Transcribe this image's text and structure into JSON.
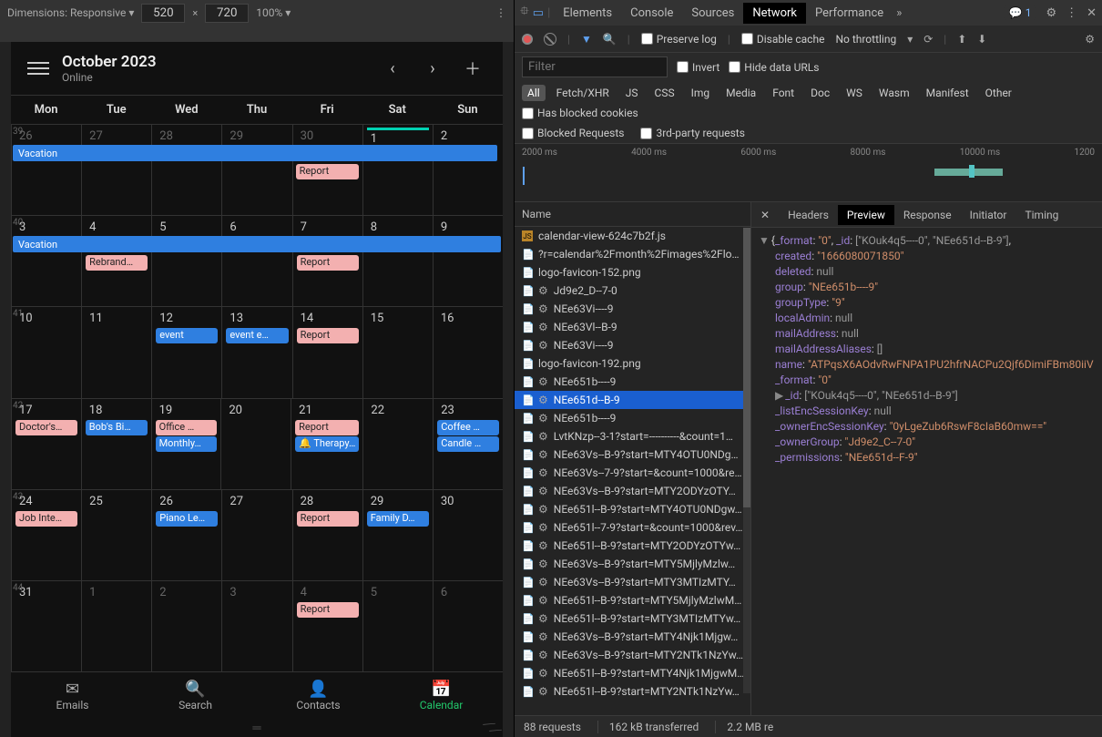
{
  "device": {
    "dimensions_label": "Dimensions: Responsive ▾",
    "width": "520",
    "height": "720",
    "zoom": "100% ▾"
  },
  "calendar": {
    "title": "October 2023",
    "status": "Online",
    "dow": [
      "Mon",
      "Tue",
      "Wed",
      "Thu",
      "Fri",
      "Sat",
      "Sun"
    ],
    "weeks": [
      {
        "no": "39",
        "days": [
          {
            "n": "26",
            "other": true
          },
          {
            "n": "27",
            "other": true
          },
          {
            "n": "28",
            "other": true
          },
          {
            "n": "29",
            "other": true
          },
          {
            "n": "30",
            "other": true
          },
          {
            "n": "1",
            "today": true
          },
          {
            "n": "2"
          }
        ],
        "span": {
          "label": "Vacation",
          "from": 0,
          "to": 7,
          "arrow": true
        }
      },
      {
        "no": "40",
        "days": [
          {
            "n": "3"
          },
          {
            "n": "4",
            "evts": [
              {
                "t": "Rebrand…",
                "c": "pink"
              }
            ]
          },
          {
            "n": "5"
          },
          {
            "n": "6"
          },
          {
            "n": "7",
            "evts": [
              {
                "t": "Report",
                "c": "pink"
              }
            ]
          },
          {
            "n": "8"
          },
          {
            "n": "9"
          }
        ],
        "span": {
          "label": "Vacation",
          "from": 0,
          "to": 7
        }
      },
      {
        "no": "41",
        "days": [
          {
            "n": "10"
          },
          {
            "n": "11"
          },
          {
            "n": "12",
            "evts": [
              {
                "t": "event",
                "c": "blue"
              }
            ]
          },
          {
            "n": "13",
            "evts": [
              {
                "t": "event e…",
                "c": "blue"
              }
            ]
          },
          {
            "n": "14",
            "evts": [
              {
                "t": "Report",
                "c": "pink"
              }
            ]
          },
          {
            "n": "15"
          },
          {
            "n": "16"
          }
        ]
      },
      {
        "no": "42",
        "days": [
          {
            "n": "17",
            "evts": [
              {
                "t": "Doctor's…",
                "c": "pink"
              }
            ]
          },
          {
            "n": "18",
            "evts": [
              {
                "t": "Bob's Bi…",
                "c": "blue"
              }
            ]
          },
          {
            "n": "19",
            "evts": [
              {
                "t": "Office …",
                "c": "pink"
              },
              {
                "t": "Monthly…",
                "c": "blue"
              }
            ]
          },
          {
            "n": "20"
          },
          {
            "n": "21",
            "evts": [
              {
                "t": "Report",
                "c": "pink"
              },
              {
                "t": "🔔 Therapy…",
                "c": "blue"
              }
            ]
          },
          {
            "n": "22"
          },
          {
            "n": "23",
            "evts": [
              {
                "t": "Coffee …",
                "c": "blue"
              },
              {
                "t": "Candle …",
                "c": "blue"
              }
            ]
          }
        ]
      },
      {
        "no": "43",
        "days": [
          {
            "n": "24",
            "evts": [
              {
                "t": "Job Inte…",
                "c": "pink"
              }
            ]
          },
          {
            "n": "25"
          },
          {
            "n": "26",
            "evts": [
              {
                "t": "Piano Le…",
                "c": "blue"
              }
            ]
          },
          {
            "n": "27"
          },
          {
            "n": "28",
            "evts": [
              {
                "t": "Report",
                "c": "pink"
              }
            ]
          },
          {
            "n": "29",
            "evts": [
              {
                "t": "Family D…",
                "c": "blue"
              }
            ]
          },
          {
            "n": "30"
          }
        ]
      },
      {
        "no": "44",
        "days": [
          {
            "n": "31"
          },
          {
            "n": "1",
            "other": true
          },
          {
            "n": "2",
            "other": true
          },
          {
            "n": "3",
            "other": true
          },
          {
            "n": "4",
            "other": true,
            "evts": [
              {
                "t": "Report",
                "c": "pink"
              }
            ]
          },
          {
            "n": "5",
            "other": true
          },
          {
            "n": "6",
            "other": true
          }
        ]
      }
    ],
    "week1_report": "Report",
    "nav": [
      {
        "icon": "✉",
        "label": "Emails"
      },
      {
        "icon": "🔍",
        "label": "Search"
      },
      {
        "icon": "👤",
        "label": "Contacts"
      },
      {
        "icon": "📅",
        "label": "Calendar",
        "active": true
      }
    ]
  },
  "devtools": {
    "tabs": [
      "Elements",
      "Console",
      "Sources",
      "Network",
      "Performance"
    ],
    "active_tab": "Network",
    "issues": "1",
    "net_toolbar": {
      "preserve": "Preserve log",
      "disable_cache": "Disable cache",
      "throttling": "No throttling"
    },
    "filter_placeholder": "Filter",
    "invert": "Invert",
    "hide_data": "Hide data URLs",
    "types": [
      "All",
      "Fetch/XHR",
      "JS",
      "CSS",
      "Img",
      "Media",
      "Font",
      "Doc",
      "WS",
      "Wasm",
      "Manifest",
      "Other"
    ],
    "blocked_cookies": "Has blocked cookies",
    "blocked_req": "Blocked Requests",
    "third_party": "3rd-party requests",
    "timeline_ticks": [
      "2000 ms",
      "4000 ms",
      "6000 ms",
      "8000 ms",
      "10000 ms",
      "1200"
    ],
    "name_header": "Name",
    "requests": [
      {
        "ic": "js",
        "name": "calendar-view-624c7b2f.js"
      },
      {
        "ic": "doc",
        "name": "?r=calendar%2Fmonth%2Fimages%2Flo…"
      },
      {
        "ic": "doc",
        "name": "logo-favicon-152.png"
      },
      {
        "ic": "xhr",
        "name": "Jd9e2_D--7-0"
      },
      {
        "ic": "xhr",
        "name": "NEe63Vi----9"
      },
      {
        "ic": "xhr",
        "name": "NEe63Vl--B-9"
      },
      {
        "ic": "xhr",
        "name": "NEe63Vi----9"
      },
      {
        "ic": "doc",
        "name": "logo-favicon-192.png"
      },
      {
        "ic": "xhr",
        "name": "NEe651b----9"
      },
      {
        "ic": "xhr",
        "name": "NEe651d--B-9",
        "selected": true
      },
      {
        "ic": "xhr",
        "name": "NEe651b----9"
      },
      {
        "ic": "xhr",
        "name": "LvtKNzp--3-1?start=----------&count=1…"
      },
      {
        "ic": "xhr",
        "name": "NEe63Vs--B-9?start=MTY4OTU0NDg…"
      },
      {
        "ic": "xhr",
        "name": "NEe63Vs--7-9?start=&count=1000&re…"
      },
      {
        "ic": "xhr",
        "name": "NEe63Vs--B-9?start=MTY2ODYzOTY…"
      },
      {
        "ic": "xhr",
        "name": "NEe651l--B-9?start=MTY4OTU0NDgw…"
      },
      {
        "ic": "xhr",
        "name": "NEe651l--7-9?start=&count=1000&rev…"
      },
      {
        "ic": "xhr",
        "name": "NEe651l--B-9?start=MTY2ODYzOTYw…"
      },
      {
        "ic": "xhr",
        "name": "NEe63Vs--B-9?start=MTY5MjlyMzlw…"
      },
      {
        "ic": "xhr",
        "name": "NEe63Vs--B-9?start=MTY3MTIzMTY…"
      },
      {
        "ic": "xhr",
        "name": "NEe651l--B-9?start=MTY5MjlyMzlwM…"
      },
      {
        "ic": "xhr",
        "name": "NEe651l--B-9?start=MTY3MTIzMTYw…"
      },
      {
        "ic": "xhr",
        "name": "NEe63Vs--B-9?start=MTY4Njk1Mjgw…"
      },
      {
        "ic": "xhr",
        "name": "NEe63Vs--B-9?start=MTY2NTk1NzYw…"
      },
      {
        "ic": "xhr",
        "name": "NEe651l--B-9?start=MTY4Njk1MjgwM…"
      },
      {
        "ic": "xhr",
        "name": "NEe651l--B-9?start=MTY2NTk1NzYw…"
      }
    ],
    "detail_tabs": [
      "Headers",
      "Preview",
      "Response",
      "Initiator",
      "Timing"
    ],
    "detail_active": "Preview",
    "preview": {
      "line0_pre": "{_format: ",
      "line0_format": "\"0\"",
      "line0_mid": ", _id: ",
      "line0_id": "[\"KOuk4q5----0\", \"NEe651d--B-9\"]",
      "created_k": "created",
      "created_v": "\"1666080071850\"",
      "deleted_k": "deleted",
      "deleted_v": "null",
      "group_k": "group",
      "group_v": "\"NEe651b----9\"",
      "groupType_k": "groupType",
      "groupType_v": "\"9\"",
      "localAdmin_k": "localAdmin",
      "localAdmin_v": "null",
      "mailAddress_k": "mailAddress",
      "mailAddress_v": "null",
      "mailAliases_k": "mailAddressAliases",
      "mailAliases_v": "[]",
      "name_k": "name",
      "name_v": "\"ATPqsX6AOdvRwFNPA1PU2hfrNACPu2Qjf6DimiFBm80iiV",
      "format_k": "_format",
      "format_v": "\"0\"",
      "id_k": "_id",
      "id_v": "[\"KOuk4q5----0\", \"NEe651d--B-9\"]",
      "listEnc_k": "_listEncSessionKey",
      "listEnc_v": "null",
      "ownerEnc_k": "_ownerEncSessionKey",
      "ownerEnc_v": "\"0yLgeZub6RswF8cIaB60mw==\"",
      "ownerGroup_k": "_ownerGroup",
      "ownerGroup_v": "\"Jd9e2_C--7-0\"",
      "perm_k": "_permissions",
      "perm_v": "\"NEe651d--F-9\""
    },
    "status": {
      "reqs": "88 requests",
      "transferred": "162 kB transferred",
      "resources": "2.2 MB re"
    }
  }
}
